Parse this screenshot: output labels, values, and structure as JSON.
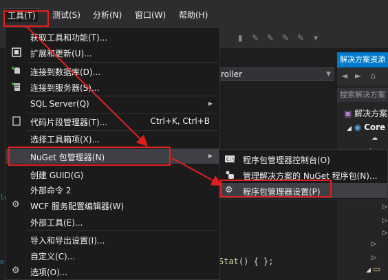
{
  "menubar": {
    "items": [
      "工具(T)",
      "测试(S)",
      "分析(N)",
      "窗口(W)",
      "帮助(H)"
    ],
    "open_item": "工具(T)"
  },
  "editor": {
    "combo_text": "roller",
    "code_fragment_call": "Stat",
    "code_fragment_rest": "() { };",
    "gutter_marks": [
      "le",
      "e"
    ]
  },
  "solution_explorer": {
    "title": "解决方案资源",
    "search_placeholder": "搜索解决方案",
    "items": [
      "解决方案",
      "Core"
    ]
  },
  "tools_menu": {
    "items": [
      {
        "label": "获取工具和功能(T)...",
        "icon": "none"
      },
      {
        "label": "扩展和更新(U)...",
        "icon": "extensions-icon"
      },
      {
        "label": "连接到数据库(D)...",
        "icon": "database-connect-icon"
      },
      {
        "label": "连接到服务器(S)...",
        "icon": "server-connect-icon"
      },
      {
        "label": "SQL Server(Q)",
        "icon": "none",
        "submenu": true
      },
      {
        "label": "代码片段管理器(T)...",
        "icon": "snippet-icon",
        "shortcut": "Ctrl+K, Ctrl+B"
      },
      {
        "label": "选择工具箱项(X)...",
        "icon": "none"
      },
      {
        "label": "NuGet 包管理器(N)",
        "icon": "none",
        "submenu": true,
        "highlighted": true
      },
      {
        "label": "创建 GUID(G)",
        "icon": "none"
      },
      {
        "label": "外部命令 2",
        "icon": "none"
      },
      {
        "label": "WCF 服务配置编辑器(W)",
        "icon": "gear-icon"
      },
      {
        "label": "外部工具(E)...",
        "icon": "none"
      },
      {
        "label": "导入和导出设置(I)...",
        "icon": "none"
      },
      {
        "label": "自定义(C)...",
        "icon": "none"
      },
      {
        "label": "选项(O)...",
        "icon": "gear-icon"
      }
    ]
  },
  "nuget_submenu": {
    "items": [
      {
        "label": "程序包管理器控制台(O)",
        "icon": "console-icon"
      },
      {
        "label": "管理解决方案的 NuGet 程序包(N)...",
        "icon": "nuget-icon"
      },
      {
        "label": "程序包管理器设置(P)",
        "icon": "gear-icon",
        "highlighted": true
      }
    ]
  },
  "colors": {
    "accent": "#007acc",
    "annotation": "#e02020",
    "menu_bg": "#1b1b1c",
    "highlight": "#3f3f46"
  }
}
